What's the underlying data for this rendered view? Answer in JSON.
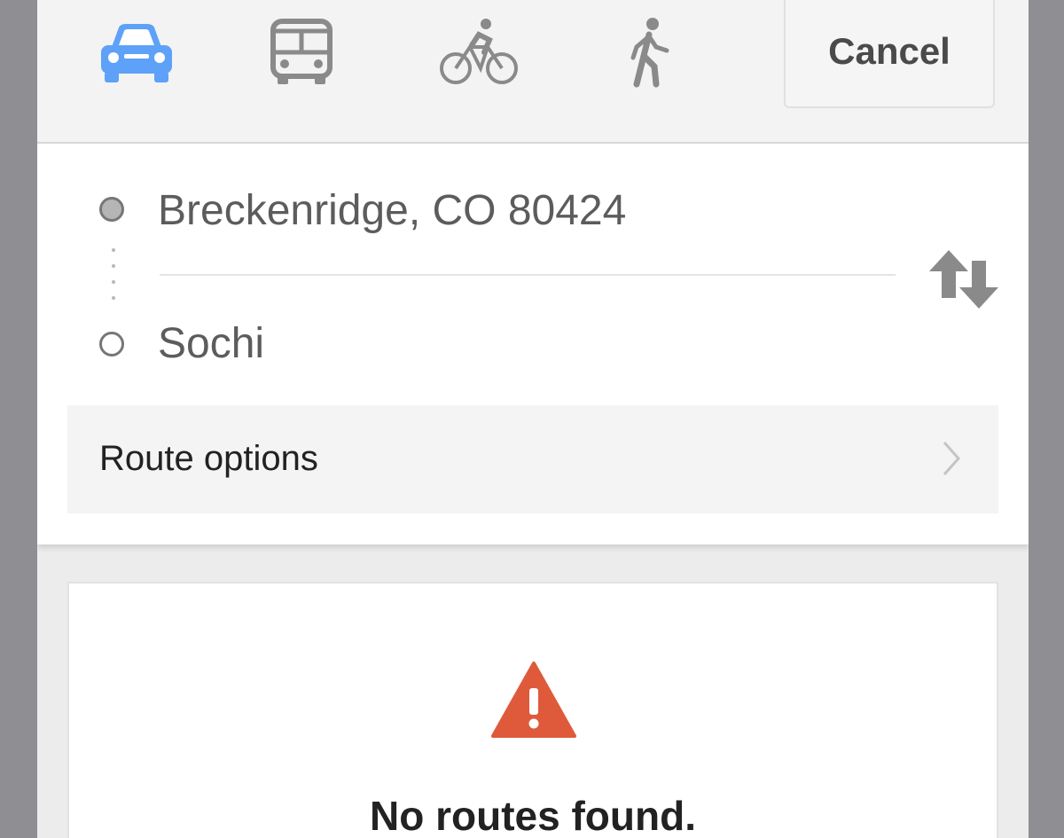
{
  "colors": {
    "accent": "#5ea1f8",
    "icon_gray": "#8a8a8a",
    "warning": "#df5a3b",
    "frame": "#8e8e93"
  },
  "modes": [
    {
      "name": "drive",
      "icon": "car-icon",
      "selected": true
    },
    {
      "name": "transit",
      "icon": "bus-icon",
      "selected": false
    },
    {
      "name": "bike",
      "icon": "bicycle-icon",
      "selected": false
    },
    {
      "name": "walk",
      "icon": "walking-icon",
      "selected": false
    }
  ],
  "header": {
    "cancel_label": "Cancel"
  },
  "directions": {
    "origin": "Breckenridge, CO 80424",
    "destination": "Sochi",
    "swap_icon": "swap-arrows-icon",
    "route_options_label": "Route options"
  },
  "result": {
    "icon": "warning-icon",
    "message": "No routes found."
  }
}
